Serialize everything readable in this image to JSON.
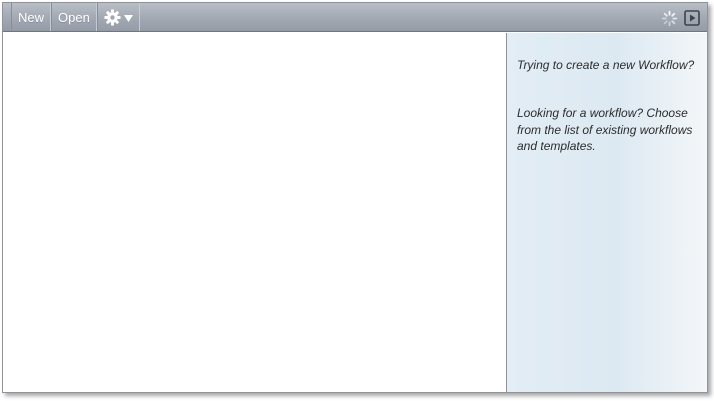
{
  "toolbar": {
    "new_label": "New",
    "open_label": "Open",
    "settings_icon": "gear-icon",
    "settings_caret": "chevron-down-icon",
    "status_icon": "loading-spinner-icon",
    "run_icon": "play-icon"
  },
  "side_panel": {
    "create_hint": "Trying to create a new Workflow?",
    "find_hint": "Looking for a workflow? Choose from the list of existing workflows and templates."
  },
  "colors": {
    "toolbar_top": "#b9bec6",
    "toolbar_bottom": "#959ba6",
    "panel_bg": "#e2edf5",
    "text": "#2c2c2c"
  }
}
